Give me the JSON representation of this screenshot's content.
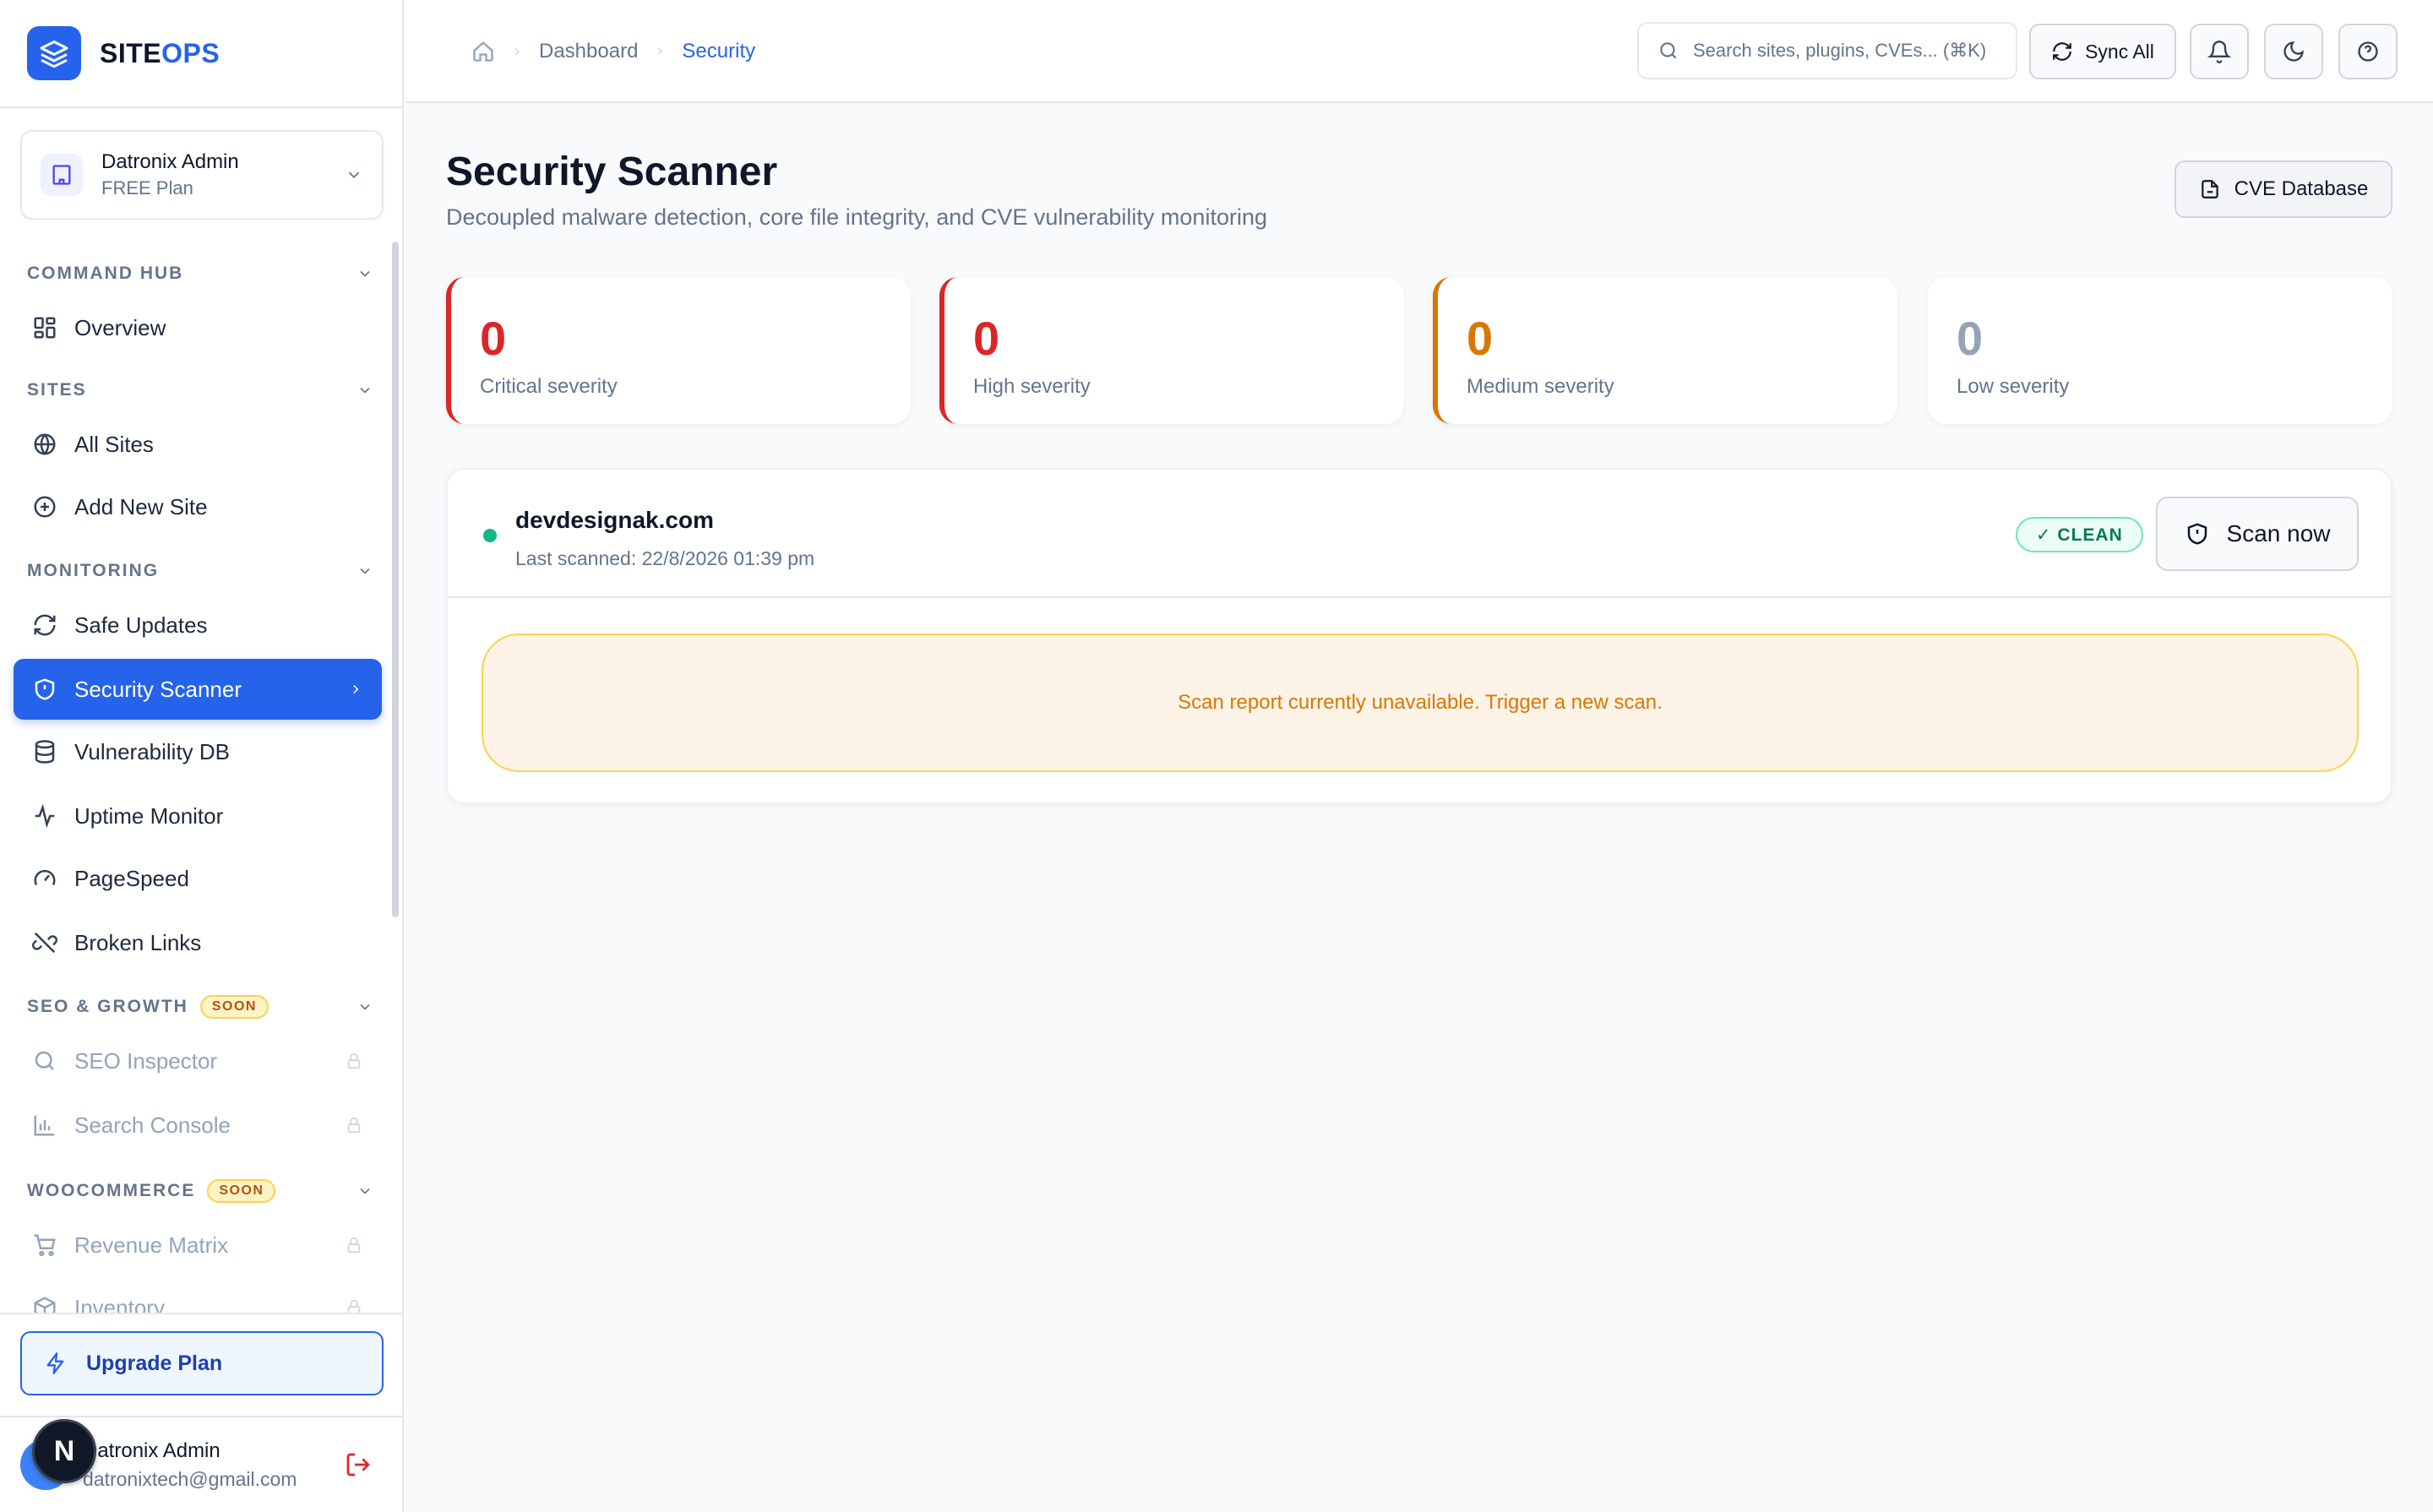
{
  "brand": {
    "name_prefix": "SITE",
    "name_suffix": "OPS"
  },
  "org": {
    "name": "Datronix Admin",
    "plan": "FREE Plan"
  },
  "sidebar": {
    "sections": {
      "command_hub": "COMMAND HUB",
      "sites": "SITES",
      "monitoring": "MONITORING",
      "seo_growth": "SEO & GROWTH",
      "woocommerce": "WOOCOMMERCE"
    },
    "soon_label": "SOON",
    "items": {
      "overview": "Overview",
      "all_sites": "All Sites",
      "add_new_site": "Add New Site",
      "safe_updates": "Safe Updates",
      "security_scanner": "Security Scanner",
      "vulnerability_db": "Vulnerability DB",
      "uptime_monitor": "Uptime Monitor",
      "pagespeed": "PageSpeed",
      "broken_links": "Broken Links",
      "seo_inspector": "SEO Inspector",
      "search_console": "Search Console",
      "revenue_matrix": "Revenue Matrix",
      "inventory": "Inventory"
    },
    "upgrade_label": "Upgrade Plan"
  },
  "user": {
    "name": "Datronix Admin",
    "email": "datronixtech@gmail.com",
    "badge_letter": "N"
  },
  "topbar": {
    "breadcrumb": {
      "dashboard": "Dashboard",
      "current": "Security"
    },
    "search_placeholder": "Search sites, plugins, CVEs... (⌘K)",
    "sync_label": "Sync All"
  },
  "page": {
    "title": "Security Scanner",
    "subtitle": "Decoupled malware detection, core file integrity, and CVE vulnerability monitoring",
    "cve_button": "CVE Database"
  },
  "stats": [
    {
      "value": "0",
      "label": "Critical severity",
      "color": "#dc2626"
    },
    {
      "value": "0",
      "label": "High severity",
      "color": "#dc2626"
    },
    {
      "value": "0",
      "label": "Medium severity",
      "color": "#d97706"
    },
    {
      "value": "0",
      "label": "Low severity",
      "color": "#94a3b8"
    }
  ],
  "site": {
    "domain": "devdesignak.com",
    "last_scanned": "Last scanned: 22/8/2026 01:39 pm",
    "status_badge": "✓ CLEAN",
    "scan_button": "Scan now",
    "report_message": "Scan report currently unavailable. Trigger a new scan."
  },
  "colors": {
    "accent": "#2563eb",
    "critical": "#dc2626",
    "medium": "#d97706",
    "low": "#94a3b8",
    "clean": "#047857"
  }
}
